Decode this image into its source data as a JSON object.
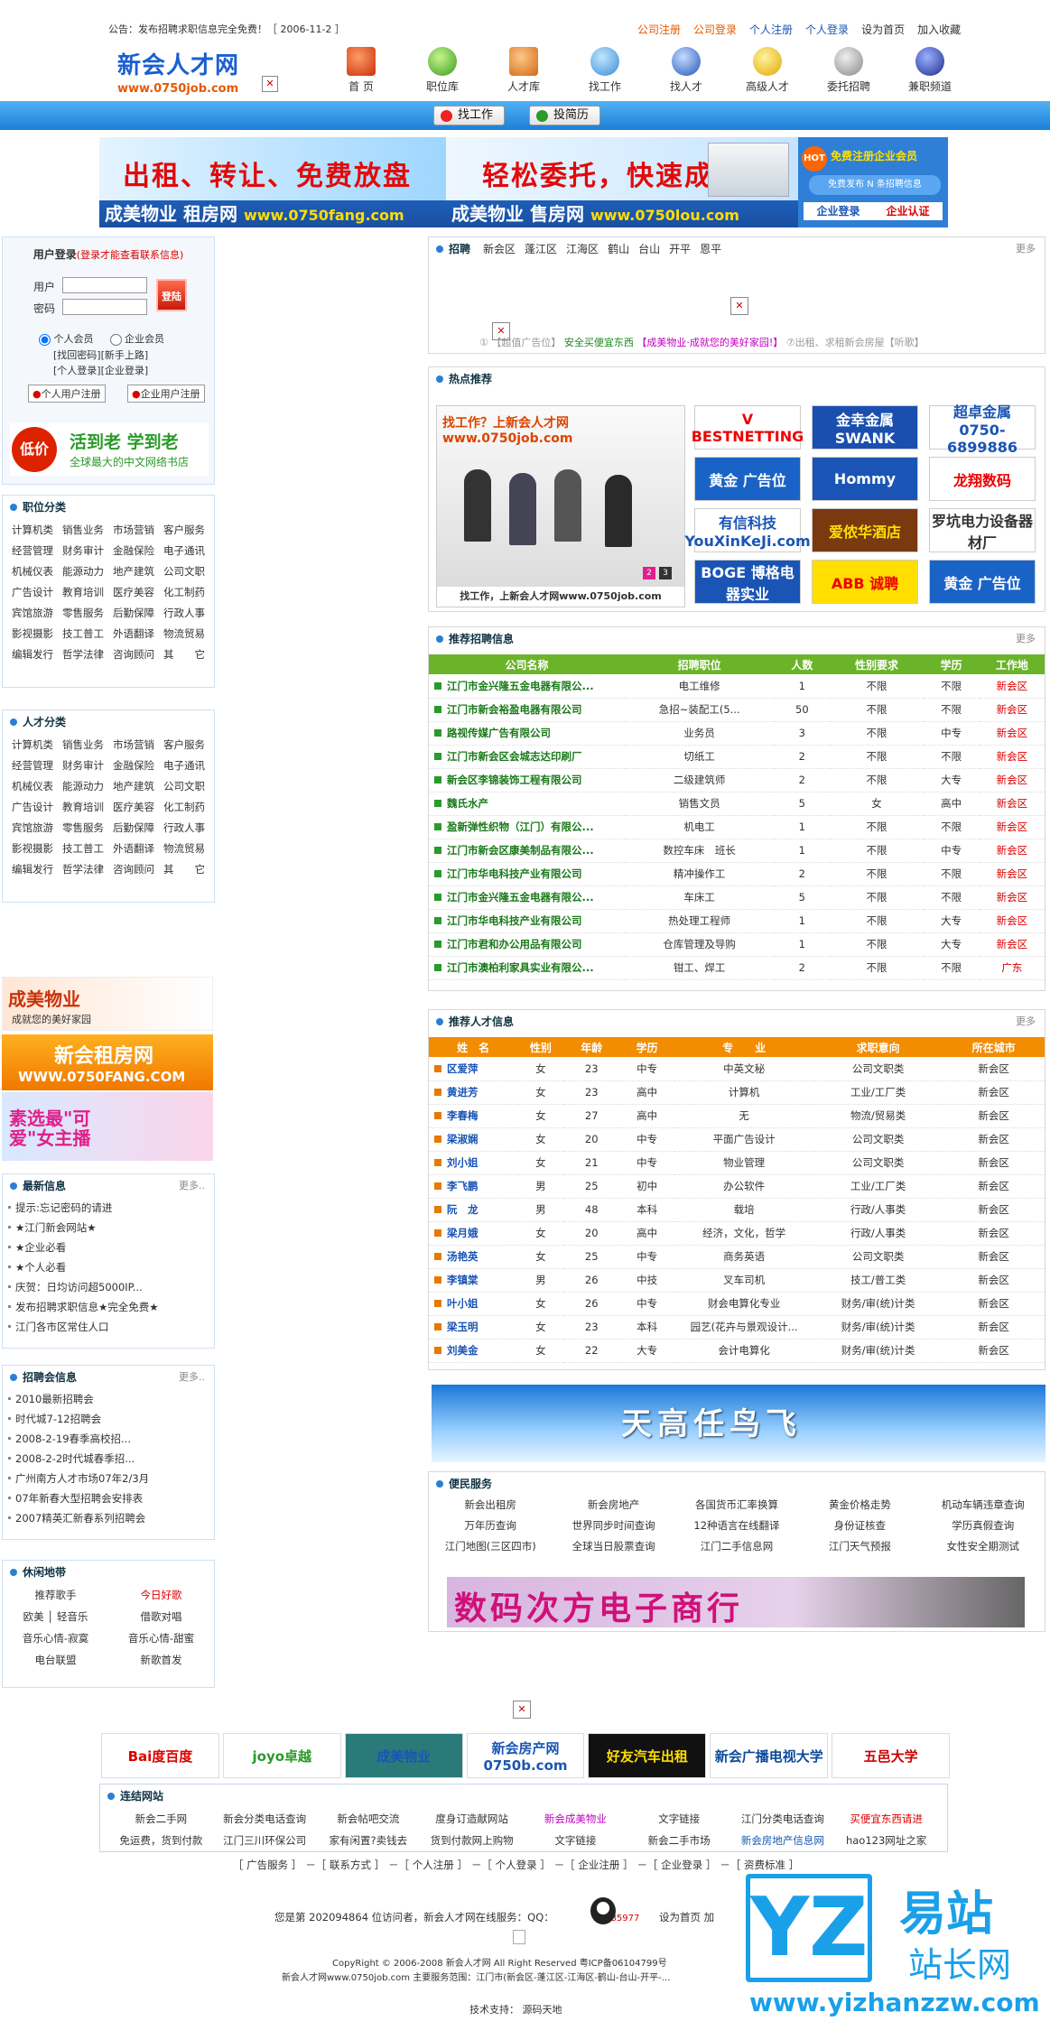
{
  "notice": "公告：发布招聘求职信息完全免费！［ 2006-11-2 ］",
  "top_links": [
    "公司注册",
    "公司登录",
    "个人注册",
    "个人登录",
    "设为首页",
    "加入收藏"
  ],
  "logo": {
    "name": "新会人才网",
    "url": "www.0750job.com"
  },
  "nav": [
    "首 页",
    "职位库",
    "人才库",
    "找工作",
    "找人才",
    "高级人才",
    "委托招聘",
    "兼职频道"
  ],
  "bar_buttons": [
    "找工作",
    "投简历"
  ],
  "banner": {
    "left_big": "出租、转让、免费放盘",
    "left_foot": "成美物业 租房网",
    "left_url": "www.0750fang.com",
    "mid_big": "轻松委托，快速成交",
    "mid_foot": "成美物业 售房网",
    "mid_url": "www.0750lou.com",
    "right_hot": "HOT",
    "right_l1": "免费注册企业会员",
    "right_l2": "免费发布 N 条招聘信息",
    "right_login": "企业登录",
    "right_cert": "企业认证"
  },
  "login": {
    "title": "用户登录",
    "title_note": "(登录才能查看联系信息)",
    "user_label": "用户",
    "pass_label": "密码",
    "submit": "登陆",
    "type_person": "个人会员",
    "type_company": "企业会员",
    "links": [
      "[找回密码]",
      "[新手上路]",
      "[个人登录]",
      "[企业登录]"
    ],
    "reg_person": "个人用户注册",
    "reg_company": "企业用户注册"
  },
  "book_ad": {
    "badge": "低价",
    "line1": "活到老 学到老",
    "line2": "全球最大的中文网络书店"
  },
  "job_categories": {
    "title": "职位分类",
    "items": [
      "计算机类",
      "销售业务",
      "市场营销",
      "客户服务",
      "经营管理",
      "财务审计",
      "金融保险",
      "电子通讯",
      "机械仪表",
      "能源动力",
      "地产建筑",
      "公司文职",
      "广告设计",
      "教育培训",
      "医疗美容",
      "化工制药",
      "宾馆旅游",
      "零售服务",
      "后勤保障",
      "行政人事",
      "影视摄影",
      "技工普工",
      "外语翻译",
      "物流贸易",
      "编辑发行",
      "哲学法律",
      "咨询顾问",
      "其　　它"
    ]
  },
  "talent_categories": {
    "title": "人才分类",
    "items": [
      "计算机类",
      "销售业务",
      "市场营销",
      "客户服务",
      "经营管理",
      "财务审计",
      "金融保险",
      "电子通讯",
      "机械仪表",
      "能源动力",
      "地产建筑",
      "公司文职",
      "广告设计",
      "教育培训",
      "医疗美容",
      "化工制药",
      "宾馆旅游",
      "零售服务",
      "后勤保障",
      "行政人事",
      "影视摄影",
      "技工普工",
      "外语翻译",
      "物流贸易",
      "编辑发行",
      "哲学法律",
      "咨询顾问",
      "其　　它"
    ]
  },
  "side_ads": [
    {
      "l1": "成美物业",
      "l2": "成就您的美好家园"
    },
    {
      "l1": "新会租房网",
      "l2": "WWW.0750FANG.COM"
    },
    {
      "l1": "素选最\"可爱\"女主播",
      "l2": ""
    }
  ],
  "latest": {
    "title": "最新信息",
    "more": "更多..",
    "items": [
      "提示:忘记密码的请进",
      "★江门新会网站★",
      "★企业必看",
      "★个人必看",
      "庆贺：日均访问超5000IP...",
      "发布招聘求职信息★完全免费★",
      "江门各市区常住人口"
    ]
  },
  "fairs": {
    "title": "招聘会信息",
    "more": "更多..",
    "items": [
      "2010最新招聘会",
      "时代城7-12招聘会",
      "2008-2-19春季高校招...",
      "2008-2-2时代城春季招...",
      "广州南方人才市场07年2/3月",
      "07年新春大型招聘会安排表",
      "2007精英汇新春系列招聘会"
    ]
  },
  "leisure": {
    "title": "休闲地带",
    "items": [
      "推荐歌手",
      "今日好歌",
      "欧美 │ 轻音乐",
      "借歌对唱",
      "音乐心情-寂寞",
      "音乐心情-甜蜜",
      "电台联盟",
      "新歌首发"
    ]
  },
  "jobs_panel": {
    "title": "招聘",
    "areas": [
      "新会区",
      "蓬江区",
      "江海区",
      "鹤山",
      "台山",
      "开平",
      "恩平"
    ],
    "more": "更多",
    "ticker_prefix": "①",
    "ticker": [
      {
        "text": "【超值广告位】",
        "color": "#999"
      },
      {
        "text": "安全买便宜东西",
        "color": "#1a8a1a"
      },
      {
        "text": "【成美物业·成就您的美好家园!】",
        "color": "#c000c0"
      },
      {
        "text": "⑦出租、求租新会房屋【听歌】",
        "color": "#999"
      }
    ]
  },
  "hot": {
    "title": "热点推荐",
    "photo_head": "找工作？上新会人才网 www.0750job.com",
    "photo_caption": "找工作，上新会人才网www.0750job.com",
    "photo_pages": [
      "2",
      "3"
    ],
    "logos": [
      {
        "text": "V BESTNETTING",
        "color": "#e00",
        "bg": "#fff"
      },
      {
        "text": "金幸金属 SWANK",
        "color": "#fff",
        "bg": "#1a4fb0"
      },
      {
        "text": "超卓金属 0750-6899886",
        "color": "#1a55b5",
        "bg": "#fff"
      },
      {
        "text": "黄金 广告位",
        "color": "#fff",
        "bg": "#1a63c6"
      },
      {
        "text": "Hommy",
        "color": "#fff",
        "bg": "#1a55b5"
      },
      {
        "text": "龙翔数码",
        "color": "#e00",
        "bg": "#fff"
      },
      {
        "text": "有信科技 YouXinKeJi.com",
        "color": "#1a55b5",
        "bg": "#fff"
      },
      {
        "text": "爱侬华酒店",
        "color": "#ffde00",
        "bg": "#7a3a10"
      },
      {
        "text": "罗坑电力设备器材厂",
        "color": "#333",
        "bg": "#fff"
      },
      {
        "text": "BOGE 博格电器实业",
        "color": "#fff",
        "bg": "#1a55b5"
      },
      {
        "text": "ABB 诚聘",
        "color": "#e00",
        "bg": "#ffde00"
      },
      {
        "text": "黄金 广告位",
        "color": "#fff",
        "bg": "#1a63c6"
      }
    ]
  },
  "recommend_jobs": {
    "title": "推荐招聘信息",
    "more": "更多",
    "headers": [
      "公司名称",
      "招聘职位",
      "人数",
      "性别要求",
      "学历",
      "工作地"
    ],
    "rows": [
      [
        "江门市金兴隆五金电器有限公...",
        "电工维修",
        "1",
        "不限",
        "不限",
        "新会区"
      ],
      [
        "江门市新会裕盈电器有限公司",
        "急招~装配工(5...",
        "50",
        "不限",
        "不限",
        "新会区"
      ],
      [
        "路视传媒广告有限公司",
        "业务员",
        "3",
        "不限",
        "中专",
        "新会区"
      ],
      [
        "江门市新会区会城志达印刷厂",
        "切纸工",
        "2",
        "不限",
        "不限",
        "新会区"
      ],
      [
        "新会区李锦装饰工程有限公司",
        "二级建筑师",
        "2",
        "不限",
        "大专",
        "新会区"
      ],
      [
        "魏氏水产",
        "销售文员",
        "5",
        "女",
        "高中",
        "新会区"
      ],
      [
        "盈新弹性织物（江门）有限公...",
        "机电工",
        "1",
        "不限",
        "不限",
        "新会区"
      ],
      [
        "江门市新会区康美制品有限公...",
        "数控车床　班长",
        "1",
        "不限",
        "中专",
        "新会区"
      ],
      [
        "江门市华电科技产业有限公司",
        "精冲操作工",
        "2",
        "不限",
        "不限",
        "新会区"
      ],
      [
        "江门市金兴隆五金电器有限公...",
        "车床工",
        "5",
        "不限",
        "不限",
        "新会区"
      ],
      [
        "江门市华电科技产业有限公司",
        "热处理工程师",
        "1",
        "不限",
        "大专",
        "新会区"
      ],
      [
        "江门市君和办公用品有限公司",
        "仓库管理及导购",
        "1",
        "不限",
        "大专",
        "新会区"
      ],
      [
        "江门市澳柏利家具实业有限公...",
        "钳工、焊工",
        "2",
        "不限",
        "不限",
        "广东"
      ]
    ]
  },
  "recommend_talents": {
    "title": "推荐人才信息",
    "more": "更多",
    "headers": [
      "姓　名",
      "性别",
      "年龄",
      "学历",
      "专　　业",
      "求职意向",
      "所在城市"
    ],
    "rows": [
      [
        "区爱萍",
        "女",
        "23",
        "中专",
        "中英文秘",
        "公司文职类",
        "新会区"
      ],
      [
        "黄进芳",
        "女",
        "23",
        "高中",
        "计算机",
        "工业/工厂类",
        "新会区"
      ],
      [
        "李春梅",
        "女",
        "27",
        "高中",
        "无",
        "物流/贸易类",
        "新会区"
      ],
      [
        "梁淑娴",
        "女",
        "20",
        "中专",
        "平面广告设计",
        "公司文职类",
        "新会区"
      ],
      [
        "刘小姐",
        "女",
        "21",
        "中专",
        "物业管理",
        "公司文职类",
        "新会区"
      ],
      [
        "李飞鹏",
        "男",
        "25",
        "初中",
        "办公软件",
        "工业/工厂类",
        "新会区"
      ],
      [
        "阮　龙",
        "男",
        "48",
        "本科",
        "载培",
        "行政/人事类",
        "新会区"
      ],
      [
        "梁月娥",
        "女",
        "20",
        "高中",
        "经济，文化，哲学",
        "行政/人事类",
        "新会区"
      ],
      [
        "汤艳英",
        "女",
        "25",
        "中专",
        "商务英语",
        "公司文职类",
        "新会区"
      ],
      [
        "李镇棠",
        "男",
        "26",
        "中技",
        "叉车司机",
        "技工/普工类",
        "新会区"
      ],
      [
        "叶小姐",
        "女",
        "26",
        "中专",
        "财会电算化专业",
        "财务/审(统)计类",
        "新会区"
      ],
      [
        "梁玉明",
        "女",
        "23",
        "本科",
        "园艺(花卉与景观设计...",
        "财务/审(统)计类",
        "新会区"
      ],
      [
        "刘美金",
        "女",
        "22",
        "大专",
        "会计电算化",
        "财务/审(统)计类",
        "新会区"
      ]
    ]
  },
  "sky_ad": "天高任鸟飞",
  "service": {
    "title": "便民服务",
    "items": [
      "新会出租房",
      "新会房地产",
      "各国货币汇率换算",
      "黄金价格走势",
      "机动车辆违章查询",
      "万年历查询",
      "世界同步时间查询",
      "12种语言在线翻译",
      "身份证核查",
      "学历真假查询",
      "江门地图(三区四市)",
      "全球当日股票查询",
      "江门二手信息网",
      "江门天气预报",
      "女性安全期测试"
    ],
    "ad_text": "数码次方电子商行"
  },
  "partners": [
    "Bai度百度",
    "joyo卓越",
    "成美物业",
    "新会房产网 0750b.com",
    "好友汽车出租",
    "新会广播电视大学",
    "五邑大学"
  ],
  "friend_links": {
    "title": "连结网站",
    "items": [
      {
        "t": "新会二手网",
        "c": "#333"
      },
      {
        "t": "新会分类电话查询",
        "c": "#333"
      },
      {
        "t": "新会帖吧交流",
        "c": "#333"
      },
      {
        "t": "度身订造献网站",
        "c": "#333"
      },
      {
        "t": "新会成美物业",
        "c": "#c000c0"
      },
      {
        "t": "文字链接",
        "c": "#333"
      },
      {
        "t": "江门分类电话查询",
        "c": "#333"
      },
      {
        "t": "买便宜东西请进",
        "c": "#d00"
      },
      {
        "t": "免运费，货到付款",
        "c": "#333"
      },
      {
        "t": "江门三川环保公司",
        "c": "#333"
      },
      {
        "t": "家有闲置?卖钱去",
        "c": "#333"
      },
      {
        "t": "货到付款网上购物",
        "c": "#333"
      },
      {
        "t": "文字链接",
        "c": "#333"
      },
      {
        "t": "新会二手市场",
        "c": "#333"
      },
      {
        "t": "新会房地产信息网",
        "c": "#1a55b5"
      },
      {
        "t": "hao123网址之家",
        "c": "#333"
      }
    ]
  },
  "footer_nav": [
    "［ 广告服务 ］",
    "－［ 联系方式 ］",
    "－［ 个人注册 ］",
    "－［ 个人登录 ］",
    "－［ 企业注册 ］",
    "－［ 企业登录 ］",
    "－［ 资费标准 ］"
  ],
  "footer": {
    "visit": "您是第 202094864 位访问者，新会人才网在线服务：QQ：",
    "qq": "26485977",
    "set_home": "设为首页 加",
    "copyright": "CopyRight © 2006-2008 新会人才网 All Right Reserved 粤ICP备06104799号",
    "scope": "新会人才网www.0750job.com 主要服务范围：江门市(新会区-蓬江区-江海区-鹤山-台山-开平-...",
    "tech": "技术支持： 源码天地"
  },
  "watermark": {
    "brand": "YZ",
    "cn": "易站",
    "sub": "站长网",
    "url": "www.yizhanzzw.com"
  }
}
